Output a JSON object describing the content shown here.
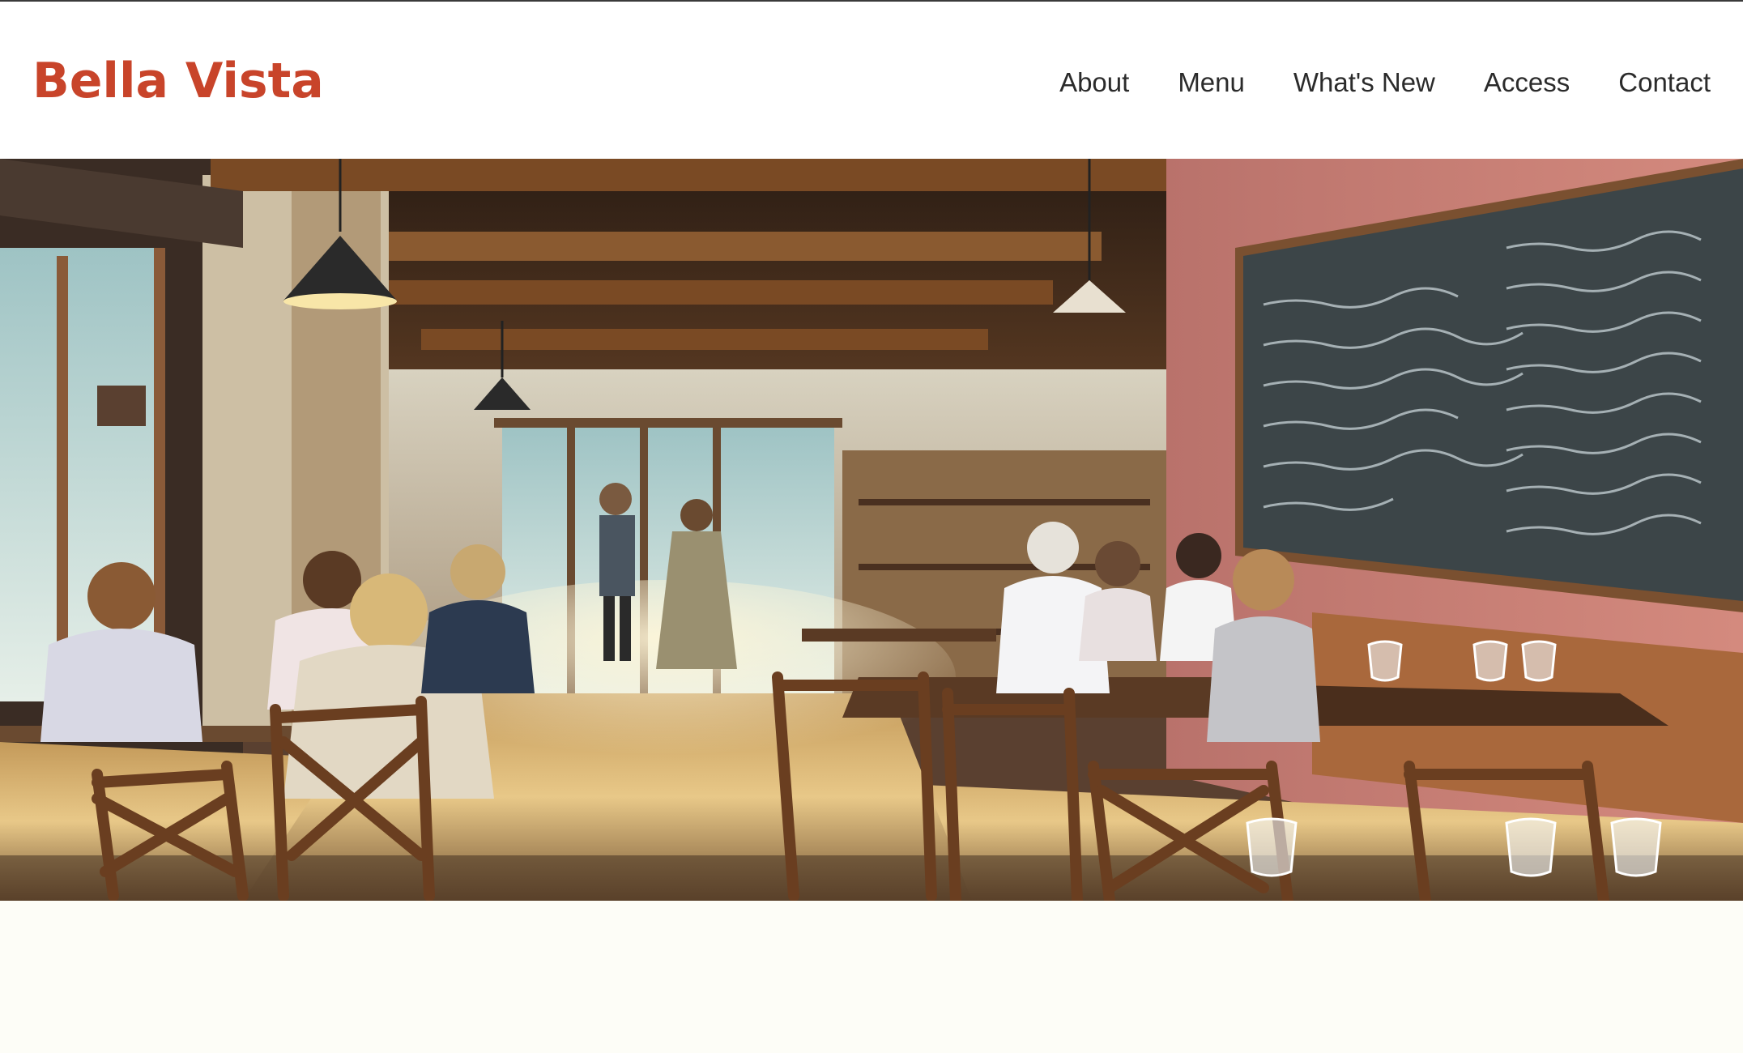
{
  "brand": {
    "name": "Bella Vista",
    "color": "#c8442a"
  },
  "nav": {
    "items": [
      {
        "label": "About"
      },
      {
        "label": "Menu"
      },
      {
        "label": "What's New"
      },
      {
        "label": "Access"
      },
      {
        "label": "Contact"
      }
    ]
  },
  "hero": {
    "image_kind": "painted restaurant interior",
    "icon": "hero-image"
  },
  "colors": {
    "background": "#fdfdf7",
    "header": "#ffffff",
    "nav_text": "#2b2b2b"
  }
}
